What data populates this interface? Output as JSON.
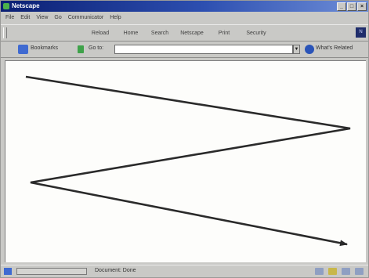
{
  "window": {
    "title": "Netscape",
    "controls": [
      "_",
      "□",
      "×"
    ]
  },
  "menu": [
    "File",
    "Edit",
    "View",
    "Go",
    "Communicator",
    "Help"
  ],
  "navigation": {
    "buttons": [
      "Reload",
      "Home",
      "Search",
      "Netscape",
      "Print",
      "Security"
    ]
  },
  "location_bar": {
    "bookmarks_label": "Bookmarks",
    "location_label": "Go to:",
    "url": "",
    "related_label": "What's Related"
  },
  "status_bar": {
    "text": "Document: Done"
  }
}
